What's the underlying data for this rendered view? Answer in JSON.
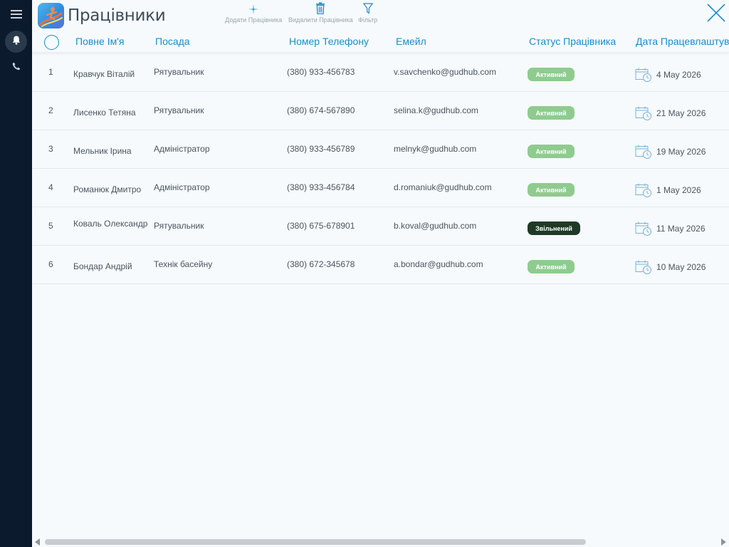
{
  "app": {
    "title": "Працівники"
  },
  "toolbar": {
    "add_label": "Додати Працівника",
    "delete_label": "Видалити Працівника",
    "filter_label": "Фільтр"
  },
  "columns": {
    "name": "Повне Ім'я",
    "position": "Посада",
    "phone": "Номер Телефону",
    "email": "Емейл",
    "status": "Статус Працівника",
    "hire_date": "Дата Працевлаштування"
  },
  "rows": [
    {
      "num": "1",
      "name": "Кравчук Віталій",
      "position": "Рятувальник",
      "phone": "(380) 933-456783",
      "email": "v.savchenko@gudhub.com",
      "status": "Активний",
      "hire_date": "4 May 2026"
    },
    {
      "num": "2",
      "name": "Лисенко Тетяна",
      "position": "Рятувальник",
      "phone": "(380) 674-567890",
      "email": "selina.k@gudhub.com",
      "status": "Активний",
      "hire_date": "21 May 2026"
    },
    {
      "num": "3",
      "name": "Мельник Ірина",
      "position": "Адміністратор",
      "phone": "(380) 933-456789",
      "email": "melnyk@gudhub.com",
      "status": "Активний",
      "hire_date": "19 May 2026"
    },
    {
      "num": "4",
      "name": "Романюк Дмитро",
      "position": "Адміністратор",
      "phone": "(380) 933-456784",
      "email": "d.romaniuk@gudhub.com",
      "status": "Активний",
      "hire_date": "1 May 2026"
    },
    {
      "num": "5",
      "name": "Коваль Олександр",
      "position": "Рятувальник",
      "phone": "(380) 675-678901",
      "email": "b.koval@gudhub.com",
      "status": "Звільнений",
      "hire_date": "11 May 2026"
    },
    {
      "num": "6",
      "name": "Бондар Андрій",
      "position": "Технік басейну",
      "phone": "(380) 672-345678",
      "email": "a.bondar@gudhub.com",
      "status": "Активний",
      "hire_date": "10 May 2026"
    }
  ],
  "colors": {
    "accent": "#1b8cc9",
    "sidebar": "#0b1a2c",
    "status_active": "#8fcb8e",
    "status_fired": "#1e3a27"
  },
  "icons": {
    "sidebar": [
      "menu-icon",
      "bell-icon",
      "phone-icon"
    ],
    "toolbar": [
      "plus-icon",
      "trash-icon",
      "filter-icon"
    ],
    "close": "close-icon",
    "date": "calendar-clock-icon"
  }
}
